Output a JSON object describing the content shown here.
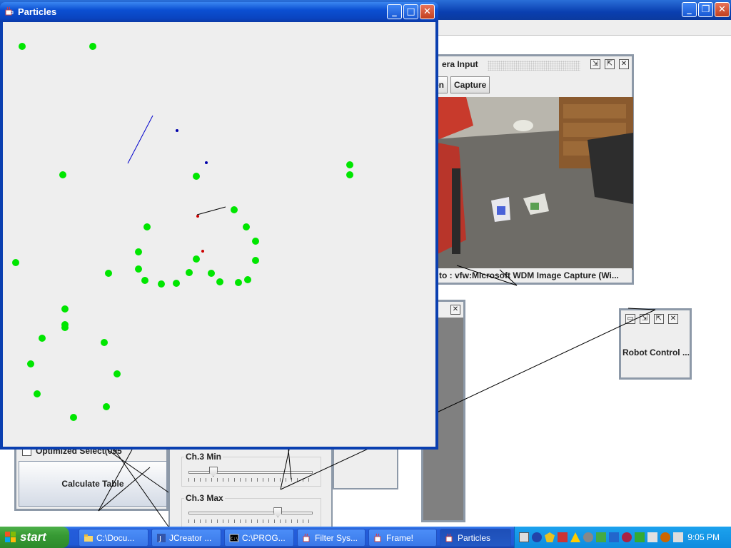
{
  "particles_window": {
    "title": "Particles",
    "controls": {
      "minimize": "_",
      "maximize": "□",
      "close": "✕"
    },
    "icon": "java-cup-icon",
    "colors": {
      "particle": "#00e600",
      "estimate_blue": "#0000aa",
      "estimate_red": "#cc0000"
    }
  },
  "camera_frame": {
    "title": "era Input",
    "toolbar": {
      "btn1": "tion",
      "btn2": "Capture"
    },
    "status": "ng to : vfw:Microsoft WDM Image Capture (Wi..."
  },
  "robot_frame": {
    "label": "Robot Control ..."
  },
  "calc_panel": {
    "checkbox_label": "Optimized Select(095",
    "button_label": "Calculate Table"
  },
  "channel_panel": {
    "min_label": "Ch.3 Min",
    "min_value": 0.2,
    "max_label": "Ch.3 Max",
    "max_value": 0.72
  },
  "taskbar": {
    "start_label": "start",
    "tasks": [
      {
        "label": "C:\\Docu...",
        "icon": "folder-icon"
      },
      {
        "label": "JCreator ...",
        "icon": "jcreator-icon"
      },
      {
        "label": "C:\\PROG...",
        "icon": "cmd-icon"
      },
      {
        "label": "Filter Sys...",
        "icon": "java-cup-icon"
      },
      {
        "label": "Frame!",
        "icon": "java-cup-icon"
      },
      {
        "label": "Particles",
        "icon": "java-cup-icon",
        "active": true
      }
    ],
    "clock": "9:05 PM"
  }
}
